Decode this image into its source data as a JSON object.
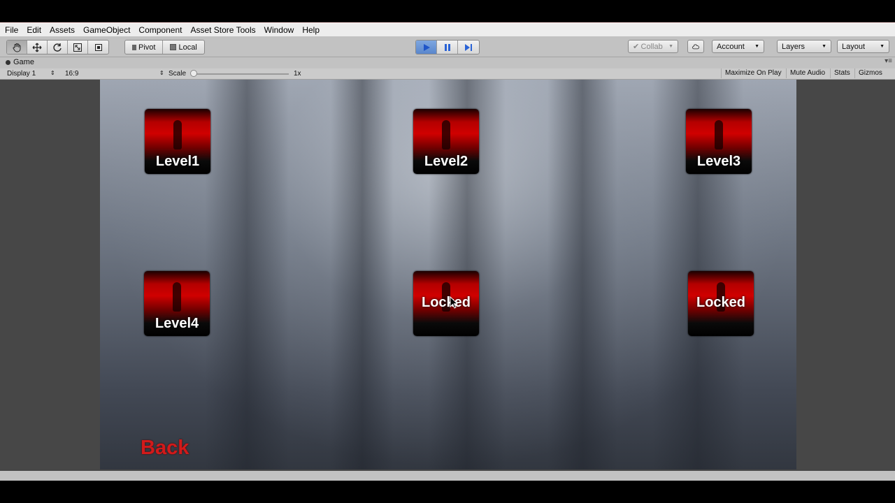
{
  "menu": [
    "File",
    "Edit",
    "Assets",
    "GameObject",
    "Component",
    "Asset Store Tools",
    "Window",
    "Help"
  ],
  "toolbar": {
    "transform_tools": [
      "hand-icon",
      "move-icon",
      "rotate-icon",
      "scale-icon",
      "rect-icon"
    ],
    "pivot_label": "Pivot",
    "local_label": "Local",
    "collab_label": "Collab",
    "account_label": "Account",
    "layers_label": "Layers",
    "layout_label": "Layout",
    "play_accent": "#5a86cc"
  },
  "tab": {
    "title": "Game"
  },
  "game_toolbar": {
    "display": "Display 1",
    "aspect": "16:9",
    "scale_label": "Scale",
    "scale_value": "1x",
    "maximize": "Maximize On Play",
    "mute": "Mute Audio",
    "stats": "Stats",
    "gizmos": "Gizmos"
  },
  "levels": [
    {
      "label": "Level1",
      "locked": false
    },
    {
      "label": "Level2",
      "locked": false
    },
    {
      "label": "Level3",
      "locked": false
    },
    {
      "label": "Level4",
      "locked": false
    },
    {
      "label": "Locked",
      "locked": true
    },
    {
      "label": "Locked",
      "locked": true
    }
  ],
  "back_label": "Back",
  "colors": {
    "back_text": "#d21a1a",
    "button_red": "#d00000"
  }
}
